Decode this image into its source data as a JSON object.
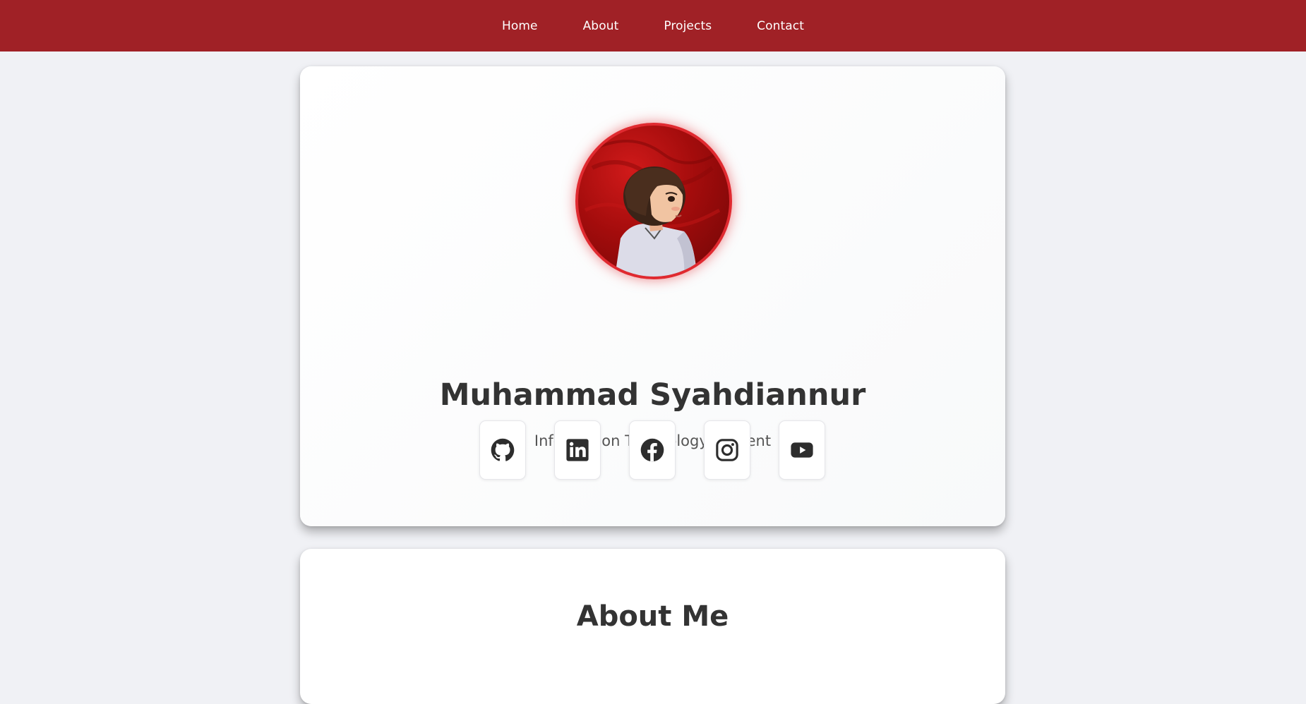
{
  "nav": {
    "items": [
      {
        "label": "Home"
      },
      {
        "label": "About"
      },
      {
        "label": "Projects"
      },
      {
        "label": "Contact"
      }
    ]
  },
  "profile": {
    "name": "Muhammad Syahdiannur",
    "role": "Information Technology Student"
  },
  "socials": [
    {
      "icon": "github-icon"
    },
    {
      "icon": "linkedin-icon"
    },
    {
      "icon": "facebook-icon"
    },
    {
      "icon": "instagram-icon"
    },
    {
      "icon": "youtube-icon"
    }
  ],
  "about": {
    "title": "About Me"
  },
  "colors": {
    "accent": "#a02126",
    "avatar_border": "#e02a30",
    "text_dark": "#333333",
    "text_muted": "#555555",
    "page_bg": "#f0f1f5"
  }
}
